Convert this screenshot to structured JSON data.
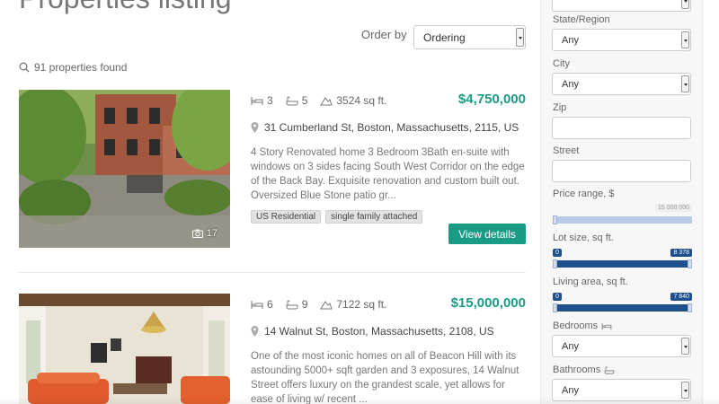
{
  "header": {
    "title": "Properties listing"
  },
  "ordering": {
    "label": "Order by",
    "selected": "Ordering"
  },
  "results": {
    "count_text": "91 properties found"
  },
  "listings": [
    {
      "beds": "3",
      "baths": "5",
      "area": "3524 sq ft.",
      "price": "$4,750,000",
      "address": "31 Cumberland St, Boston, Massachusetts, 2115, US",
      "description": "4 Story Renovated home 3 Bedroom 3Bath en-suite with windows on 3 sides facing South West Corridor on the edge of the Back Bay. Exquisite renovation and custom built out. Oversized Blue Stone patio gr...",
      "tags": [
        "US Residential",
        "single family attached"
      ],
      "photo_count": "17",
      "cta": "View details"
    },
    {
      "beds": "6",
      "baths": "9",
      "area": "7122 sq ft.",
      "price": "$15,000,000",
      "address": "14 Walnut St, Boston, Massachusetts, 2108, US",
      "description": "One of the most iconic homes on all of Beacon Hill with its astounding 5000+ sqft garden and 3 exposures, 14 Walnut Street offers luxury on the grandest scale, yet allows for ease of living w/ recent ..."
    }
  ],
  "filters": {
    "state": {
      "label": "State/Region",
      "value": "Any"
    },
    "city": {
      "label": "City",
      "value": "Any"
    },
    "zip": {
      "label": "Zip",
      "value": ""
    },
    "street": {
      "label": "Street",
      "value": ""
    },
    "price_range": {
      "label": "Price range, $",
      "max": "15 000 000"
    },
    "lot_size": {
      "label": "Lot size, sq ft.",
      "min": "0",
      "max": "8 378"
    },
    "living_area": {
      "label": "Living area, sq ft.",
      "min": "0",
      "max": "7 840"
    },
    "bedrooms": {
      "label": "Bedrooms",
      "value": "Any"
    },
    "bathrooms": {
      "label": "Bathrooms",
      "value": "Any"
    }
  },
  "colors": {
    "accent": "#1a9b86",
    "slider": "#1f4f8c",
    "slider_track": "#b9cbe8"
  }
}
